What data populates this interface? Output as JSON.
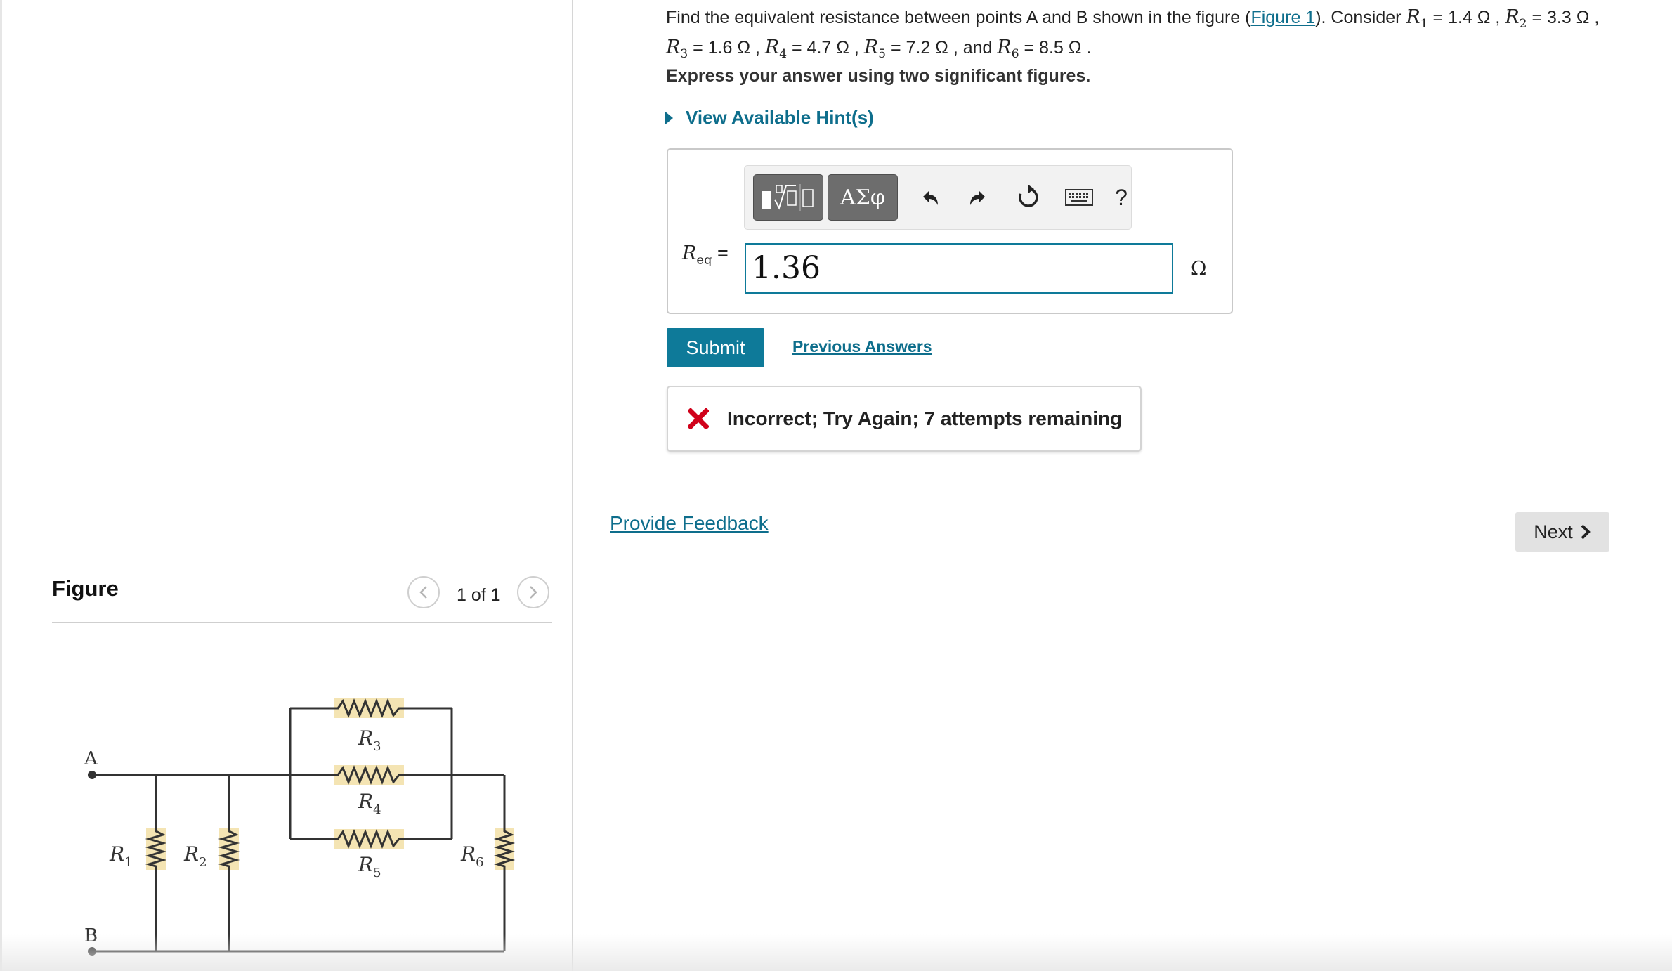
{
  "question": {
    "intro": "Find the equivalent resistance between points A and B shown in the figure (",
    "figure_link": "Figure 1",
    "after_link": "). Consider ",
    "resistors": [
      {
        "symbol": "R",
        "sub": "1",
        "value": "= 1.4 Ω ,"
      },
      {
        "symbol": "R",
        "sub": "2",
        "value": "= 3.3 Ω ,"
      },
      {
        "symbol": "R",
        "sub": "3",
        "value": "= 1.6 Ω ,"
      },
      {
        "symbol": "R",
        "sub": "4",
        "value": "= 4.7 Ω ,"
      },
      {
        "symbol": "R",
        "sub": "5",
        "value": "= 7.2 Ω , and"
      },
      {
        "symbol": "R",
        "sub": "6",
        "value": "= 8.5 Ω ."
      }
    ],
    "instruction": "Express your answer using two significant figures.",
    "hints_label": "View Available Hint(s)"
  },
  "answer": {
    "toolbar": {
      "templates_icon": "sqrt-template-icon",
      "greek_label": "ΑΣφ",
      "undo_icon": "undo-icon",
      "redo_icon": "redo-icon",
      "reset_icon": "reset-icon",
      "keyboard_icon": "keyboard-icon",
      "help_label": "?"
    },
    "label_symbol": "R",
    "label_sub": "eq",
    "label_eq": "=",
    "value": "1.36",
    "unit": "Ω"
  },
  "actions": {
    "submit_label": "Submit",
    "previous_answers_label": "Previous Answers"
  },
  "feedback": {
    "status": "incorrect",
    "message": "Incorrect; Try Again; 7 attempts remaining",
    "color": "#d0021b"
  },
  "provide_feedback_label": "Provide Feedback",
  "next_label": "Next",
  "figure": {
    "title": "Figure",
    "pager": "1 of 1",
    "circuit_labels": {
      "A": "A",
      "B": "B",
      "R1": [
        "R",
        "1"
      ],
      "R2": [
        "R",
        "2"
      ],
      "R3": [
        "R",
        "3"
      ],
      "R4": [
        "R",
        "4"
      ],
      "R5": [
        "R",
        "5"
      ],
      "R6": [
        "R",
        "6"
      ]
    }
  },
  "colors": {
    "accent": "#0e7a99",
    "link": "#0e6e8c",
    "resistor_fill": "#f4e4b3"
  }
}
